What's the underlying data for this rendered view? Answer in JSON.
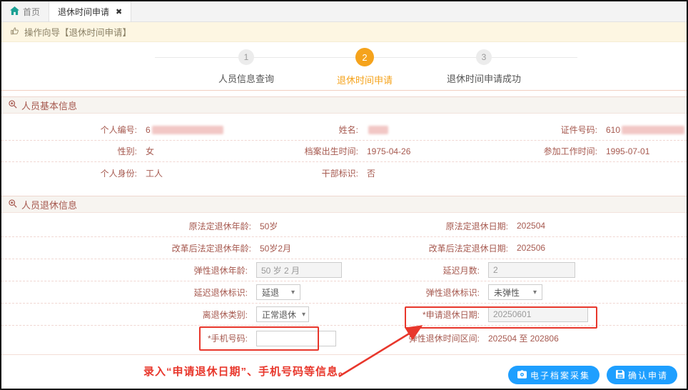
{
  "tabs": {
    "home_label": "首页",
    "active_label": "退休时间申请",
    "close_glyph": "✖"
  },
  "guide": {
    "text": "操作向导【退休时间申请】"
  },
  "stepper": {
    "steps": [
      {
        "num": "1",
        "label": "人员信息查询",
        "active": false
      },
      {
        "num": "2",
        "label": "退休时间申请",
        "active": true
      },
      {
        "num": "3",
        "label": "退休时间申请成功",
        "active": false
      }
    ]
  },
  "basic": {
    "title": "人员基本信息",
    "row1": {
      "f1": {
        "label": "个人编号:",
        "value": "6"
      },
      "f2": {
        "label": "姓名:",
        "value": ""
      },
      "f3": {
        "label": "证件号码:",
        "value": "610"
      }
    },
    "row2": {
      "f1": {
        "label": "性别:",
        "value": "女"
      },
      "f2": {
        "label": "档案出生时间:",
        "value": "1975-04-26"
      },
      "f3": {
        "label": "参加工作时间:",
        "value": "1995-07-01"
      }
    },
    "row3": {
      "f1": {
        "label": "个人身份:",
        "value": "工人"
      },
      "f2": {
        "label": "干部标识:",
        "value": "否"
      }
    }
  },
  "retire": {
    "title": "人员退休信息",
    "row1": {
      "l1": "原法定退休年龄:",
      "v1": "50岁",
      "l2": "原法定退休日期:",
      "v2": "202504"
    },
    "row2": {
      "l1": "改革后法定退休年龄:",
      "v1": "50岁2月",
      "l2": "改革后法定退休日期:",
      "v2": "202506"
    },
    "row3": {
      "l1": "弹性退休年龄:",
      "v1": "50 岁 2 月",
      "l2": "延迟月数:",
      "v2": "2"
    },
    "row4": {
      "l1": "延迟退休标识:",
      "v1": "延退",
      "l2": "弹性退休标识:",
      "v2": "未弹性"
    },
    "row5": {
      "l1": "离退休类别:",
      "v1": "正常退休",
      "l2": "*申请退休日期:",
      "v2": "20250601"
    },
    "row6": {
      "l1": "*手机号码:",
      "v1": "",
      "l2": "弹性退休时间区间:",
      "v2": "202504 至 202806"
    }
  },
  "annotation": {
    "text": "录入“申请退休日期”、手机号码等信息。"
  },
  "buttons": {
    "archive": "电子档案采集",
    "confirm": "确认申请"
  },
  "colors": {
    "step_active": "#f5a31c",
    "label_text": "#a6594f",
    "button_blue": "#1e9fff",
    "highlight_red": "#e8372c",
    "home_icon_green": "#1aa094",
    "guide_bar_bg": "#fdf6e2"
  }
}
